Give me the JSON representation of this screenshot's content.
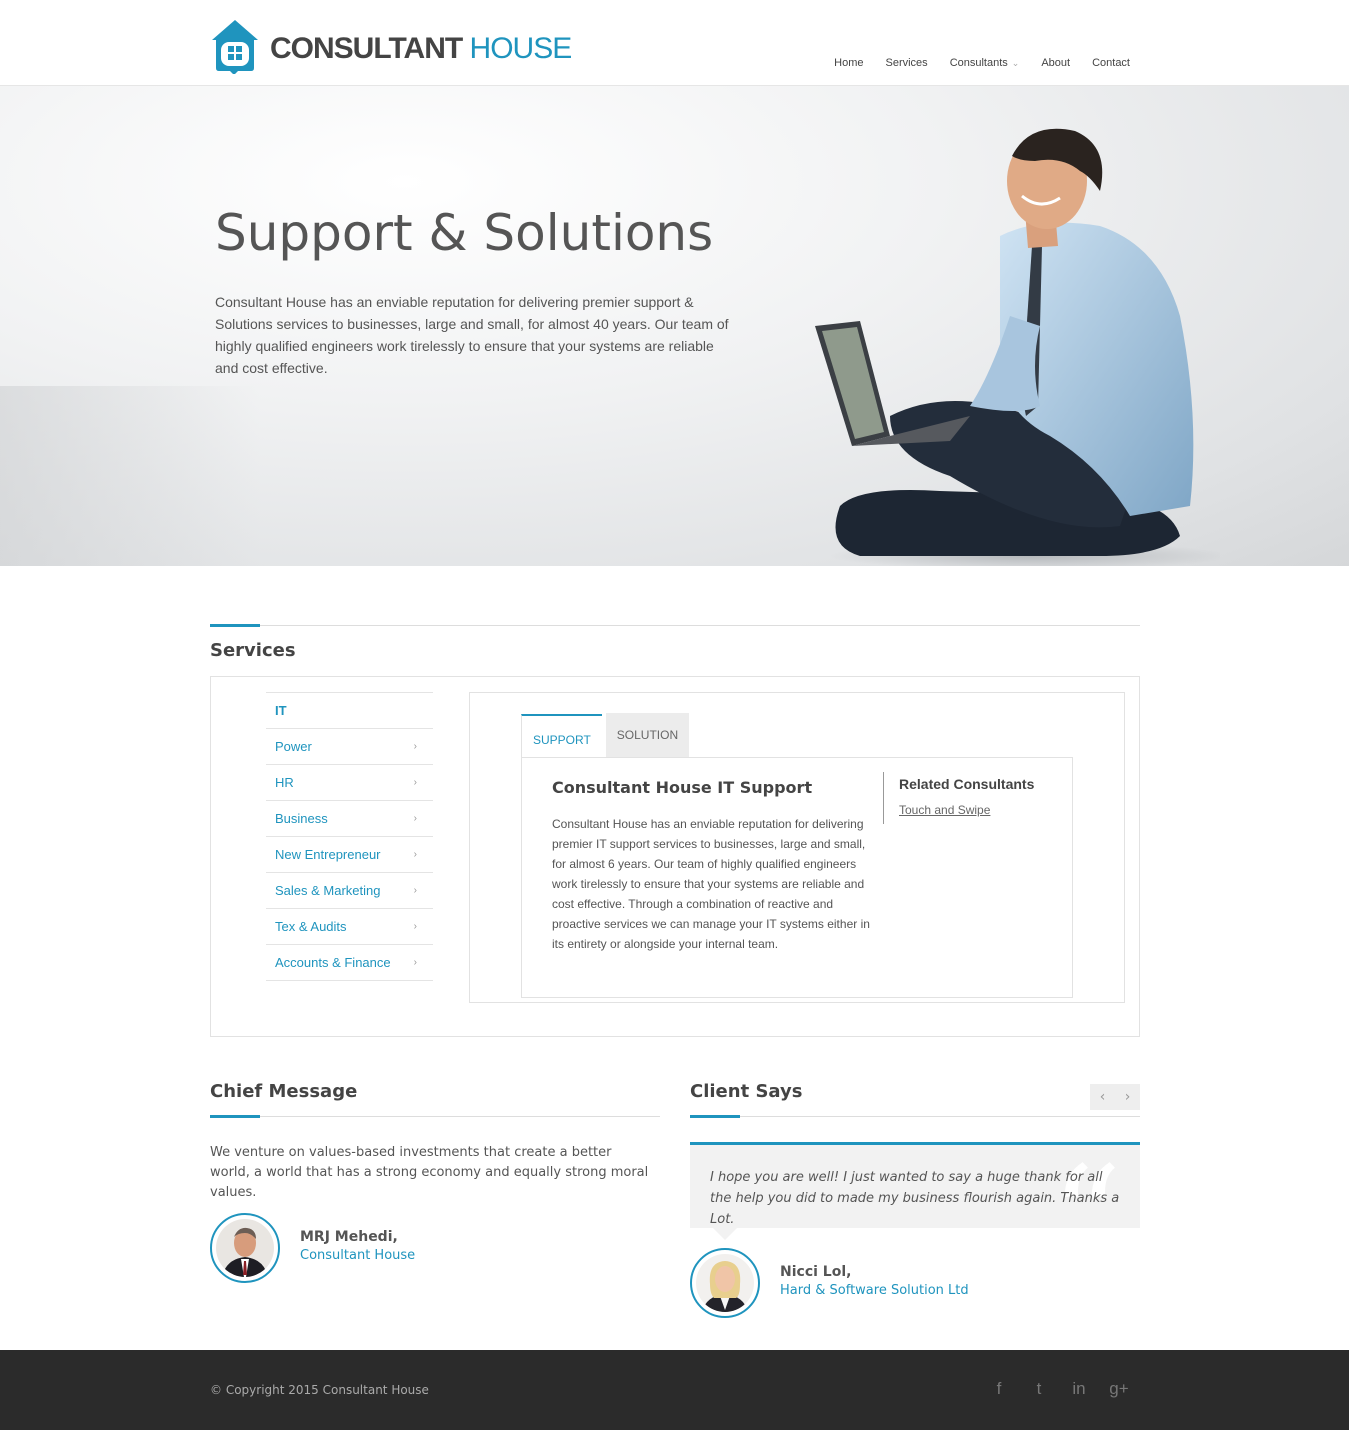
{
  "brand": {
    "name_bold": "CONSULTANT",
    "name_light": "HOUSE",
    "logo_icon": "house-window-icon",
    "accent_color": "#1f94be"
  },
  "nav": {
    "items": [
      {
        "label": "Home"
      },
      {
        "label": "Services"
      },
      {
        "label": "Consultants",
        "has_dropdown": true
      },
      {
        "label": "About"
      },
      {
        "label": "Contact"
      }
    ]
  },
  "hero": {
    "title": "Support & Solutions",
    "text": "Consultant House has an enviable reputation for delivering premier support & Solutions services to businesses, large and small, for almost 40 years. Our team of highly qualified engineers work tirelessly to ensure that your systems are reliable and cost effective."
  },
  "services": {
    "title": "Services",
    "items": [
      {
        "label": "IT",
        "active": true
      },
      {
        "label": "Power"
      },
      {
        "label": "HR"
      },
      {
        "label": "Business"
      },
      {
        "label": "New Entrepreneur"
      },
      {
        "label": "Sales & Marketing"
      },
      {
        "label": "Tex & Audits"
      },
      {
        "label": "Accounts & Finance"
      }
    ],
    "tabs": [
      {
        "label": "SUPPORT",
        "active": true
      },
      {
        "label": "SOLUTION"
      }
    ],
    "content_title": "Consultant House IT Support",
    "content_text": "Consultant House has an enviable reputation for delivering premier IT support services to businesses, large and small, for almost 6 years.  Our team of highly qualified engineers work tirelessly to ensure that your systems are reliable and cost effective.  Through a combination of reactive and proactive services we can manage your IT systems either in its entirety or alongside your internal team.",
    "related_title": "Related Consultants",
    "related_link": "Touch and Swipe"
  },
  "chief": {
    "title": "Chief Message",
    "text": "We venture on values-based investments that create a better world, a world that has a strong economy and equally strong moral values.",
    "name": "MRJ Mehedi,",
    "role": "Consultant House"
  },
  "client": {
    "title": "Client Says",
    "quote": "I hope you are well! I just wanted to say a huge thank for all the help you did to made my business flourish again. Thanks a Lot.",
    "name": "Nicci Lol,",
    "role": "Hard & Software Solution Ltd",
    "prev_glyph": "‹",
    "next_glyph": "›"
  },
  "footer": {
    "copyright": "© Copyright 2015 Consultant House",
    "socials": [
      {
        "icon": "facebook-icon",
        "glyph": "f"
      },
      {
        "icon": "twitter-icon",
        "glyph": "t"
      },
      {
        "icon": "linkedin-icon",
        "glyph": "in"
      },
      {
        "icon": "googleplus-icon",
        "glyph": "g+"
      }
    ]
  }
}
